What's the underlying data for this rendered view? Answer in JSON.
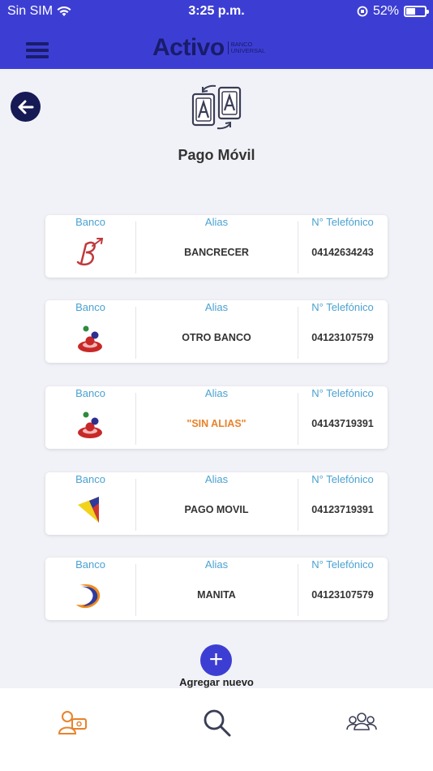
{
  "status": {
    "carrier": "Sin SIM",
    "time": "3:25 p.m.",
    "battery": "52%",
    "battery_level": 0.52
  },
  "header": {
    "brand_name": "Activo",
    "brand_sub_1": "BANCO",
    "brand_sub_2": "UNIVERSAL",
    "colors": {
      "primary": "#3c3ed3",
      "brand_dark": "#191c6b"
    }
  },
  "page": {
    "title": "Pago Móvil"
  },
  "table": {
    "head_bank": "Banco",
    "head_alias": "Alias",
    "head_phone": "N° Telefónico",
    "rows": [
      {
        "bank_icon": "bancrecer-logo-icon",
        "alias": "BANCRECER",
        "phone": "04142634243"
      },
      {
        "bank_icon": "otro-banco-logo-icon",
        "alias": "OTRO BANCO",
        "phone": "04123107579"
      },
      {
        "bank_icon": "otro-banco-logo-icon",
        "alias": "\"SIN ALIAS\"",
        "phone": "04143719391"
      },
      {
        "bank_icon": "venezuela-flag-logo-icon",
        "alias": "PAGO MOVIL",
        "phone": "04123719391"
      },
      {
        "bank_icon": "crescent-logo-icon",
        "alias": "MANITA",
        "phone": "04123107579"
      }
    ]
  },
  "add": {
    "label": "Agregar nuevo",
    "icon": "plus-icon"
  },
  "tabbar": {
    "items": [
      "contacts-card-icon",
      "search-icon",
      "group-icon"
    ],
    "active_color": "#e8822a"
  }
}
